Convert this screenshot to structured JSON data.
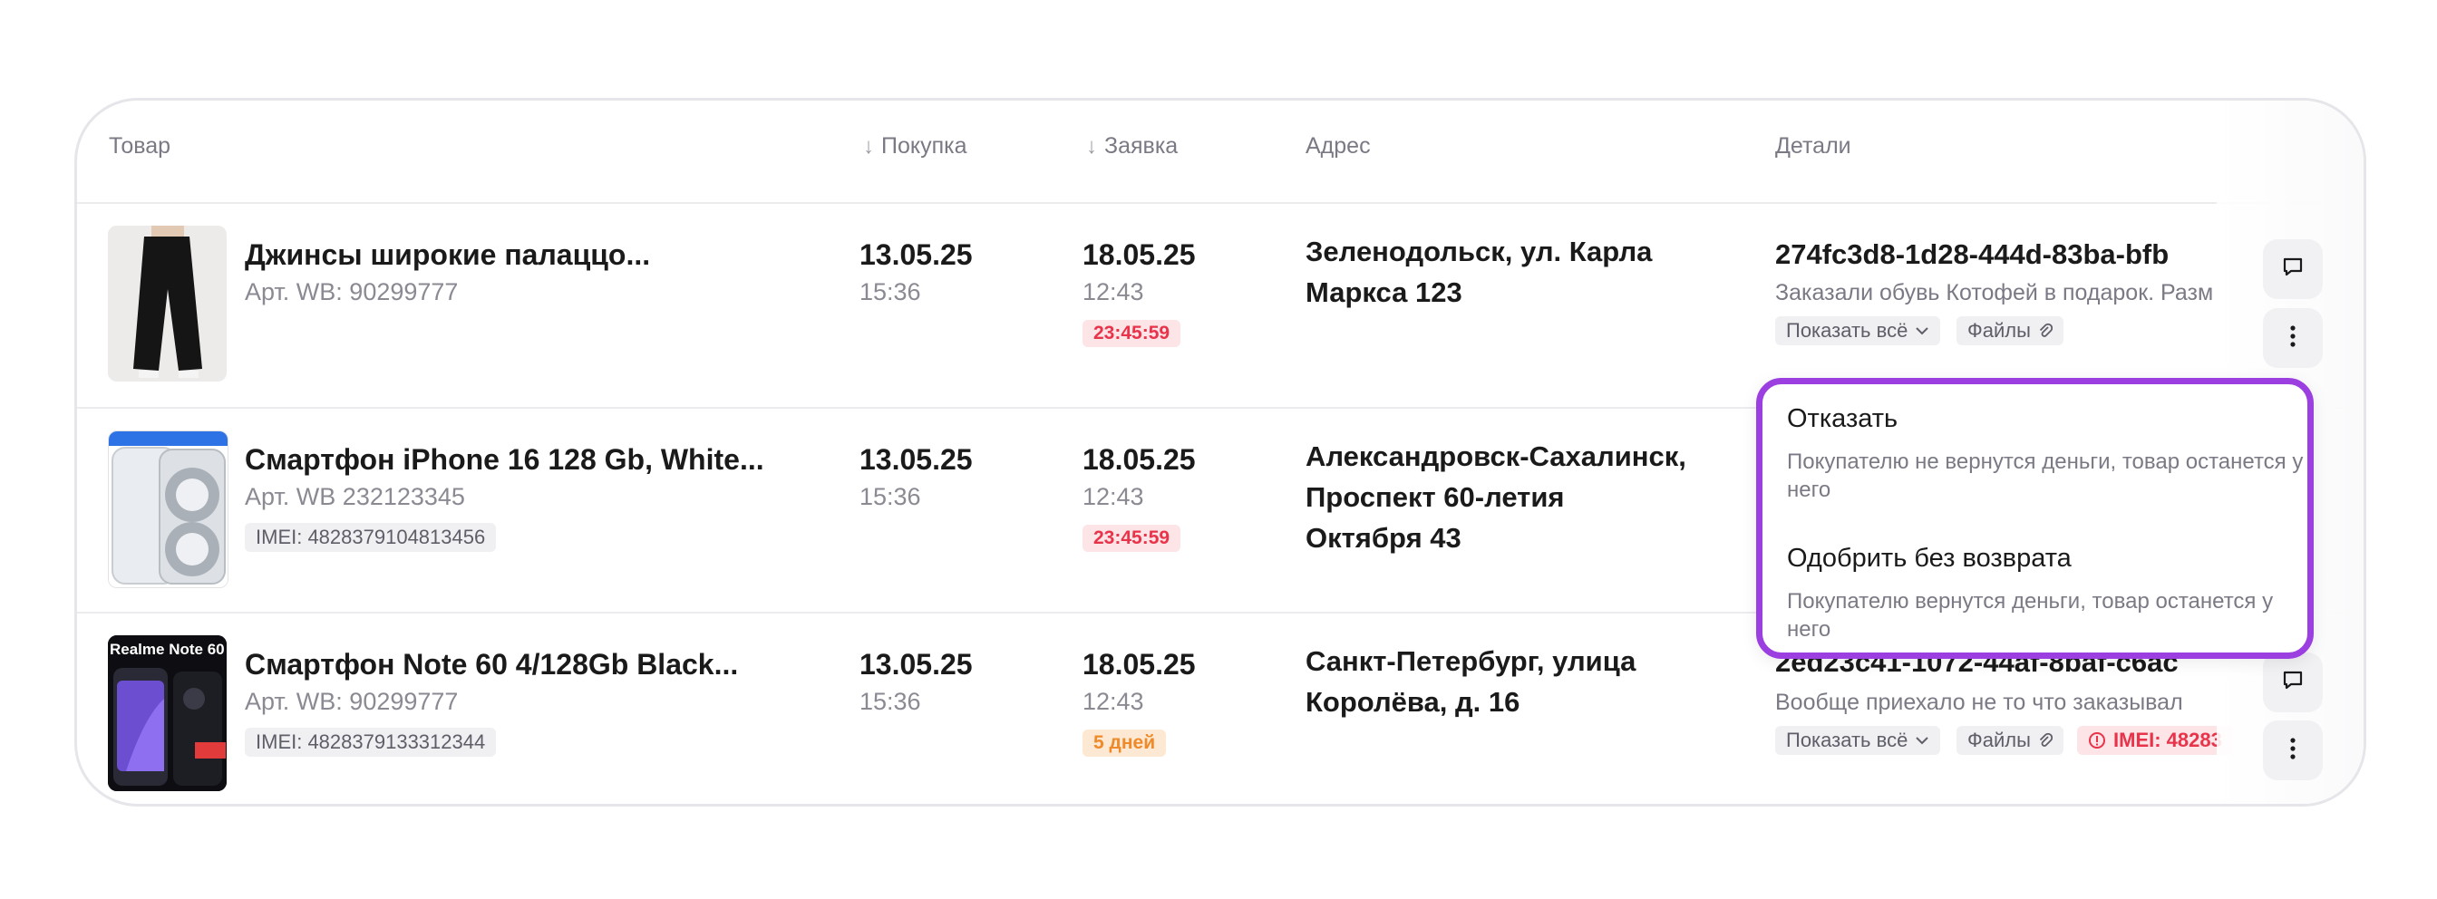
{
  "table": {
    "headers": {
      "product": "Товар",
      "purchase": "Покупка",
      "request": "Заявка",
      "address": "Адрес",
      "details": "Детали"
    }
  },
  "rows": [
    {
      "name": "Джинсы широкие палаццо...",
      "article": "Арт. WB: 90299777",
      "purchase_date": "13.05.25",
      "purchase_time": "15:36",
      "request_date": "18.05.25",
      "request_time": "12:43",
      "timer": "23:45:59",
      "address": "Зеленодольск,  ул. Карла Маркса 123",
      "details_title": "274fc3d8-1d28-444d-83ba-bfb",
      "details_text": "Заказали обувь Котофей в подарок. Разм",
      "show_all": "Показать всё",
      "files": "Файлы"
    },
    {
      "name": "Смартфон iPhone 16 128 Gb, White...",
      "article": "Арт. WB 232123345",
      "imei": "IMEI: 4828379104813456",
      "purchase_date": "13.05.25",
      "purchase_time": "15:36",
      "request_date": "18.05.25",
      "request_time": "12:43",
      "timer": "23:45:59",
      "address": "Александровск-Сахалинск,  Проспект 60-летия Октября 43"
    },
    {
      "name": "Смартфон Note 60 4/128Gb Black...",
      "article": "Арт. WB: 90299777",
      "imei": "IMEI: 4828379133312344",
      "purchase_date": "13.05.25",
      "purchase_time": "15:36",
      "request_date": "18.05.25",
      "request_time": "12:43",
      "timer": "5 дней",
      "address": "Санкт-Петербург,  улица Королёва, д. 16",
      "details_title": "2ed23c41-1072-44af-8baf-c6ac",
      "details_text": "Вообще приехало не то что заказывал",
      "show_all": "Показать всё",
      "files": "Файлы",
      "imei_alert": "IMEI: 48283",
      "thumb_caption": "Realme Note 60"
    }
  ],
  "menu": {
    "items": [
      {
        "title": "Отказать",
        "desc": "Покупателю не вернутся деньги, товар останется у него"
      },
      {
        "title": "Одобрить без возврата",
        "desc": "Покупателю вернутся деньги, товар останется у него"
      }
    ]
  },
  "icons": {
    "arrow": "↓",
    "comment": "comment-icon",
    "more": "more-vertical-icon"
  },
  "colors": {
    "accent_menu_border": "#9b3fe0",
    "timer_red": "#e8334a",
    "timer_orange": "#ef8a2a"
  }
}
